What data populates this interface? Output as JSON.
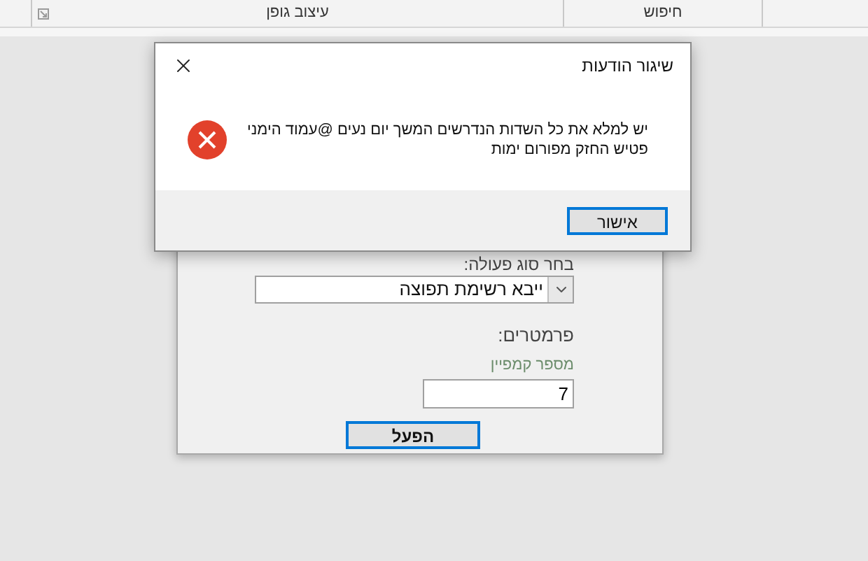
{
  "ribbon": {
    "groups": [
      {
        "label": "חיפוש"
      },
      {
        "label": "עיצוב גופן"
      }
    ]
  },
  "form": {
    "action_label": "בחר סוג פעולה:",
    "action_value": "ייבא רשימת תפוצה",
    "params_heading": "פרמטרים:",
    "campaign_label": "מספר קמפיין",
    "campaign_value": "7",
    "run_button": "הפעל"
  },
  "dialog": {
    "title": "שיגור הודעות",
    "message": "יש למלא את כל השדות הנדרשים המשך יום נעים @עמוד הימני פטיש החזק מפורום ימות",
    "ok_button": "אישור"
  }
}
